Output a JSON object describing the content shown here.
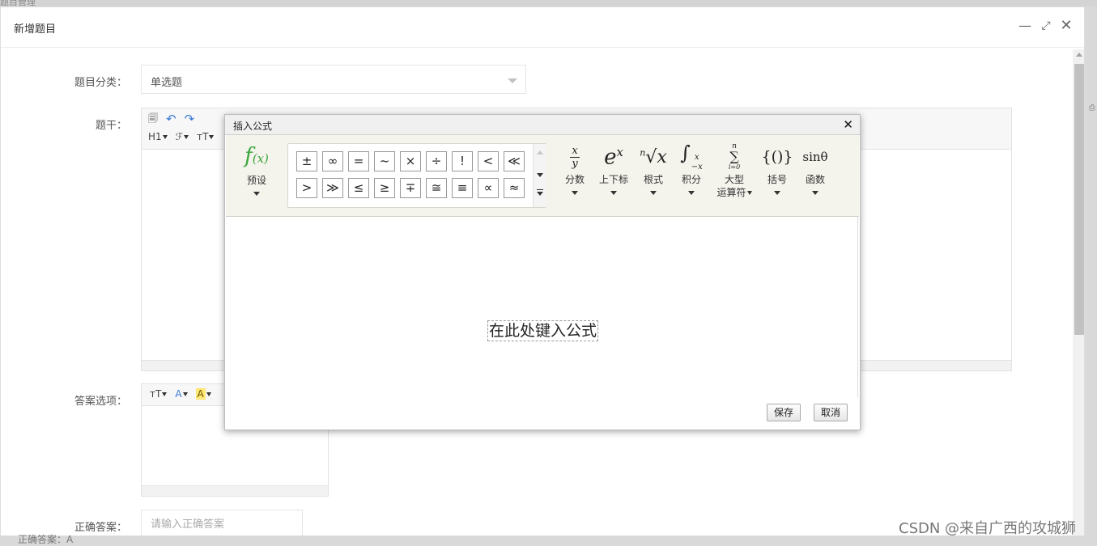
{
  "window": {
    "title": "新增题目"
  },
  "form": {
    "category_label": "题目分类：",
    "category_value": "单选题",
    "stem_label": "题干：",
    "options_label": "答案选项：",
    "answer_label": "正确答案：",
    "answer_placeholder": "请输入正确答案"
  },
  "stem_toolbar": {
    "heading": "H1",
    "font": "ℱ",
    "size": "тT"
  },
  "options_toolbar": {
    "size": "тT",
    "font_color": "A",
    "bg_color": "A"
  },
  "dialog": {
    "title": "插入公式",
    "preset_label": "预设",
    "symbols": [
      "±",
      "∞",
      "=",
      "~",
      "×",
      "÷",
      "!",
      "<",
      "≪",
      ">",
      "≫",
      "≤",
      "≥",
      "∓",
      "≅",
      "≡",
      "∝",
      "≈"
    ],
    "tools": [
      {
        "id": "fraction",
        "label": "分数"
      },
      {
        "id": "script",
        "label": "上下标"
      },
      {
        "id": "radical",
        "label": "根式"
      },
      {
        "id": "integral",
        "label": "积分"
      },
      {
        "id": "large-operator",
        "label": "大型",
        "label2": "运算符"
      },
      {
        "id": "bracket",
        "label": "括号"
      },
      {
        "id": "function",
        "label": "函数"
      }
    ],
    "glyphs": {
      "frac_num": "x",
      "frac_den": "y",
      "exp_base": "e",
      "exp_sup": "x",
      "root_index": "n",
      "root_body": "√x",
      "int_sign": "∫",
      "int_upper": "x",
      "int_lower": "−x",
      "sum_upper": "n",
      "sum_sign": "∑",
      "sum_lower": "i=0",
      "bracket": "{()}",
      "function": "sinθ"
    },
    "placeholder": "在此处键入公式",
    "save_label": "保存",
    "cancel_label": "取消"
  },
  "background": {
    "top_text": "题目管理",
    "bottom_text": "正确答案：A"
  },
  "watermark": "CSDN @来自广西的攻城狮"
}
